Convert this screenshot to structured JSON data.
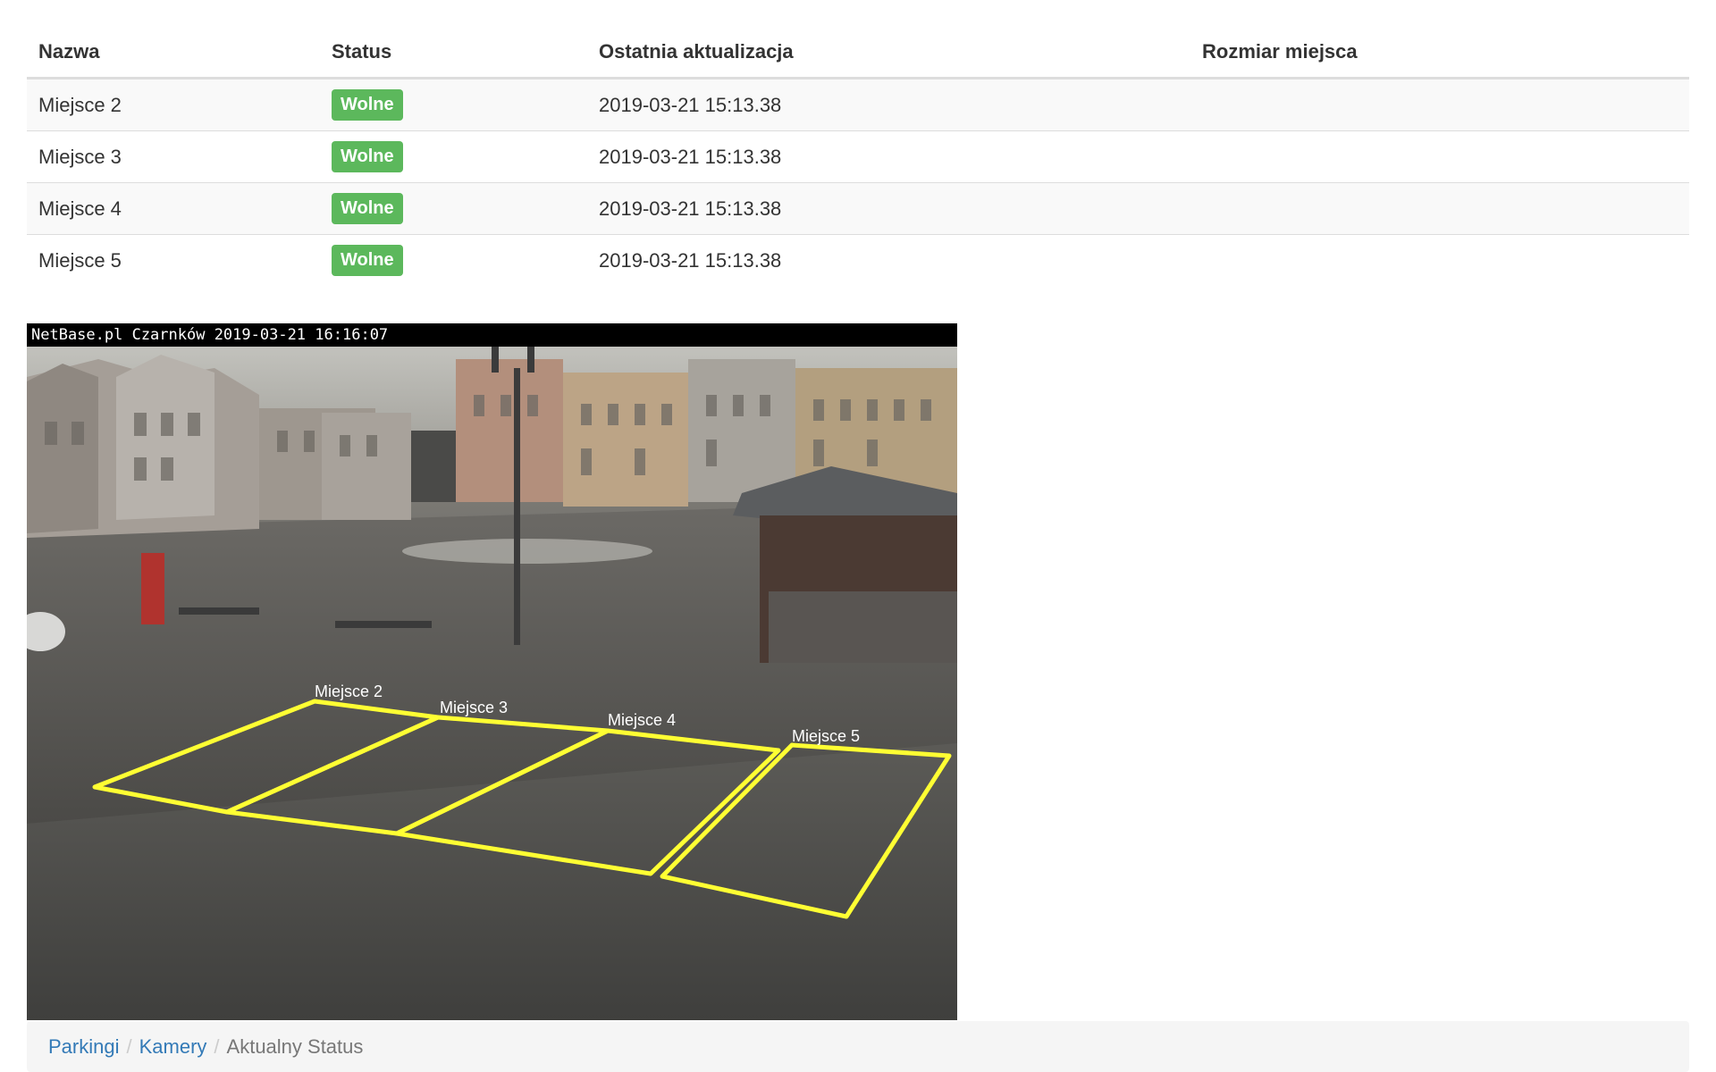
{
  "table": {
    "headers": [
      "Nazwa",
      "Status",
      "Ostatnia aktualizacja",
      "Rozmiar miejsca"
    ],
    "rows": [
      {
        "name": "Miejsce 2",
        "status": "Wolne",
        "updated": "2019-03-21 15:13.38",
        "size": ""
      },
      {
        "name": "Miejsce 3",
        "status": "Wolne",
        "updated": "2019-03-21 15:13.38",
        "size": ""
      },
      {
        "name": "Miejsce 4",
        "status": "Wolne",
        "updated": "2019-03-21 15:13.38",
        "size": ""
      },
      {
        "name": "Miejsce 5",
        "status": "Wolne",
        "updated": "2019-03-21 15:13.38",
        "size": ""
      }
    ]
  },
  "camera": {
    "overlay_text": "NetBase.pl Czarnków 2019-03-21 16:16:07",
    "spot_labels": [
      "Miejsce 2",
      "Miejsce 3",
      "Miejsce 4",
      "Miejsce 5"
    ]
  },
  "breadcrumb": {
    "items": [
      "Parkingi",
      "Kamery"
    ],
    "active": "Aktualny Status",
    "separator": "/"
  },
  "colors": {
    "status_free": "#5cb85c",
    "link": "#337ab7",
    "overlay": "#ffff33"
  }
}
